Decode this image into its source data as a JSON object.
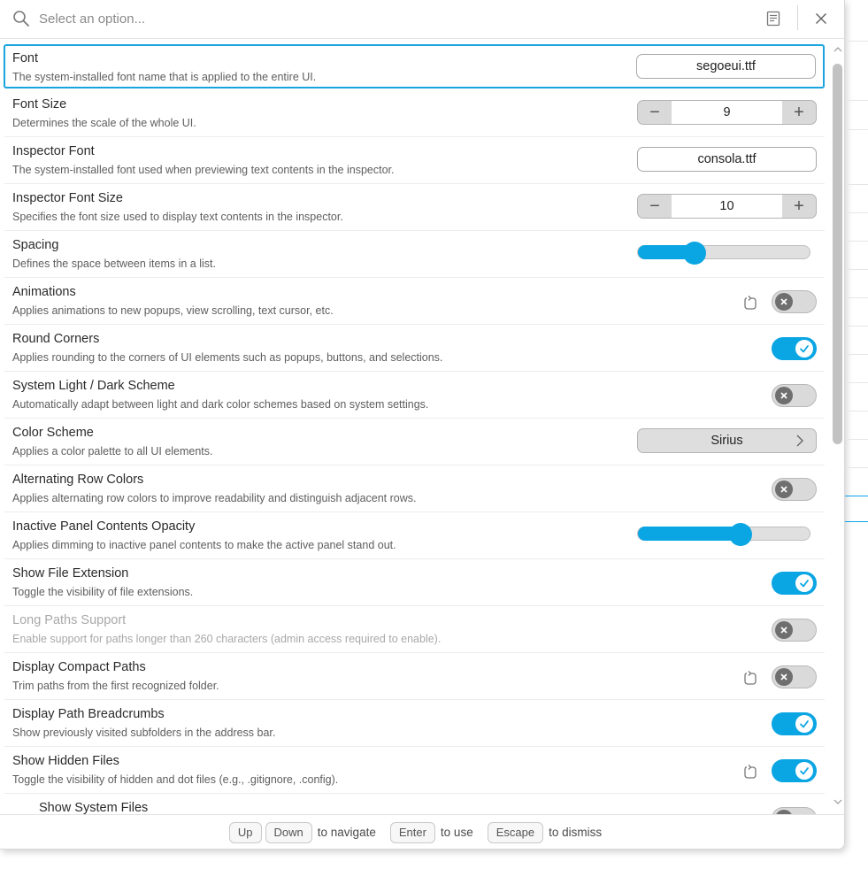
{
  "search": {
    "placeholder": "Select an option...",
    "value": ""
  },
  "settings": [
    {
      "title": "Font",
      "desc": "The system-installed font name that is applied to the entire UI.",
      "control": "text",
      "value": "segoeui.ttf",
      "selected": true
    },
    {
      "title": "Font Size",
      "desc": "Determines the scale of the whole UI.",
      "control": "stepper",
      "value": "9"
    },
    {
      "title": "Inspector Font",
      "desc": "The system-installed font used when previewing text contents in the inspector.",
      "control": "text",
      "value": "consola.ttf"
    },
    {
      "title": "Inspector Font Size",
      "desc": "Specifies the font size used to display text contents in the inspector.",
      "control": "stepper",
      "value": "10"
    },
    {
      "title": "Spacing",
      "desc": "Defines the space between items in a list.",
      "control": "slider",
      "level": 0.33
    },
    {
      "title": "Animations",
      "desc": "Applies animations to new popups, view scrolling, text cursor, etc.",
      "control": "toggle",
      "on": false,
      "reset": true
    },
    {
      "title": "Round Corners",
      "desc": "Applies rounding to the corners of UI elements such as popups, buttons, and selections.",
      "control": "toggle",
      "on": true
    },
    {
      "title": "System Light / Dark Scheme",
      "desc": "Automatically adapt between light and dark color schemes based on system settings.",
      "control": "toggle",
      "on": false
    },
    {
      "title": "Color Scheme",
      "desc": "Applies a color palette to all UI elements.",
      "control": "select",
      "value": "Sirius"
    },
    {
      "title": "Alternating Row Colors",
      "desc": "Applies alternating row colors to improve readability and distinguish adjacent rows.",
      "control": "toggle",
      "on": false
    },
    {
      "title": "Inactive Panel Contents Opacity",
      "desc": "Applies dimming to inactive panel contents to make the active panel stand out.",
      "control": "slider",
      "level": 0.6
    },
    {
      "title": "Show File Extension",
      "desc": "Toggle the visibility of file extensions.",
      "control": "toggle",
      "on": true
    },
    {
      "title": "Long Paths Support",
      "desc": "Enable support for paths longer than 260 characters (admin access required to enable).",
      "control": "toggle",
      "on": false,
      "disabled": true
    },
    {
      "title": "Display Compact Paths",
      "desc": "Trim paths from the first recognized folder.",
      "control": "toggle",
      "on": false,
      "reset": true
    },
    {
      "title": "Display Path Breadcrumbs",
      "desc": "Show previously visited subfolders in the address bar.",
      "control": "toggle",
      "on": true
    },
    {
      "title": "Show Hidden Files",
      "desc": "Toggle the visibility of hidden and dot files (e.g., .gitignore, .config).",
      "control": "toggle",
      "on": true,
      "reset": true
    },
    {
      "title": "Show System Files",
      "desc": "",
      "control": "toggle",
      "on": false,
      "partial": true
    }
  ],
  "footer": {
    "hints": [
      {
        "keys": [
          "Up",
          "Down"
        ],
        "label": "to navigate"
      },
      {
        "keys": [
          "Enter"
        ],
        "label": "to use"
      },
      {
        "keys": [
          "Escape"
        ],
        "label": "to dismiss"
      }
    ]
  },
  "colors": {
    "accent": "#0aa5e3",
    "toggle_off": "#dadada",
    "knob_off": "#6f6f6f"
  },
  "icons": {
    "search": "search-icon",
    "notes": "notes-icon",
    "close": "close-icon",
    "reset": "reset-icon"
  }
}
